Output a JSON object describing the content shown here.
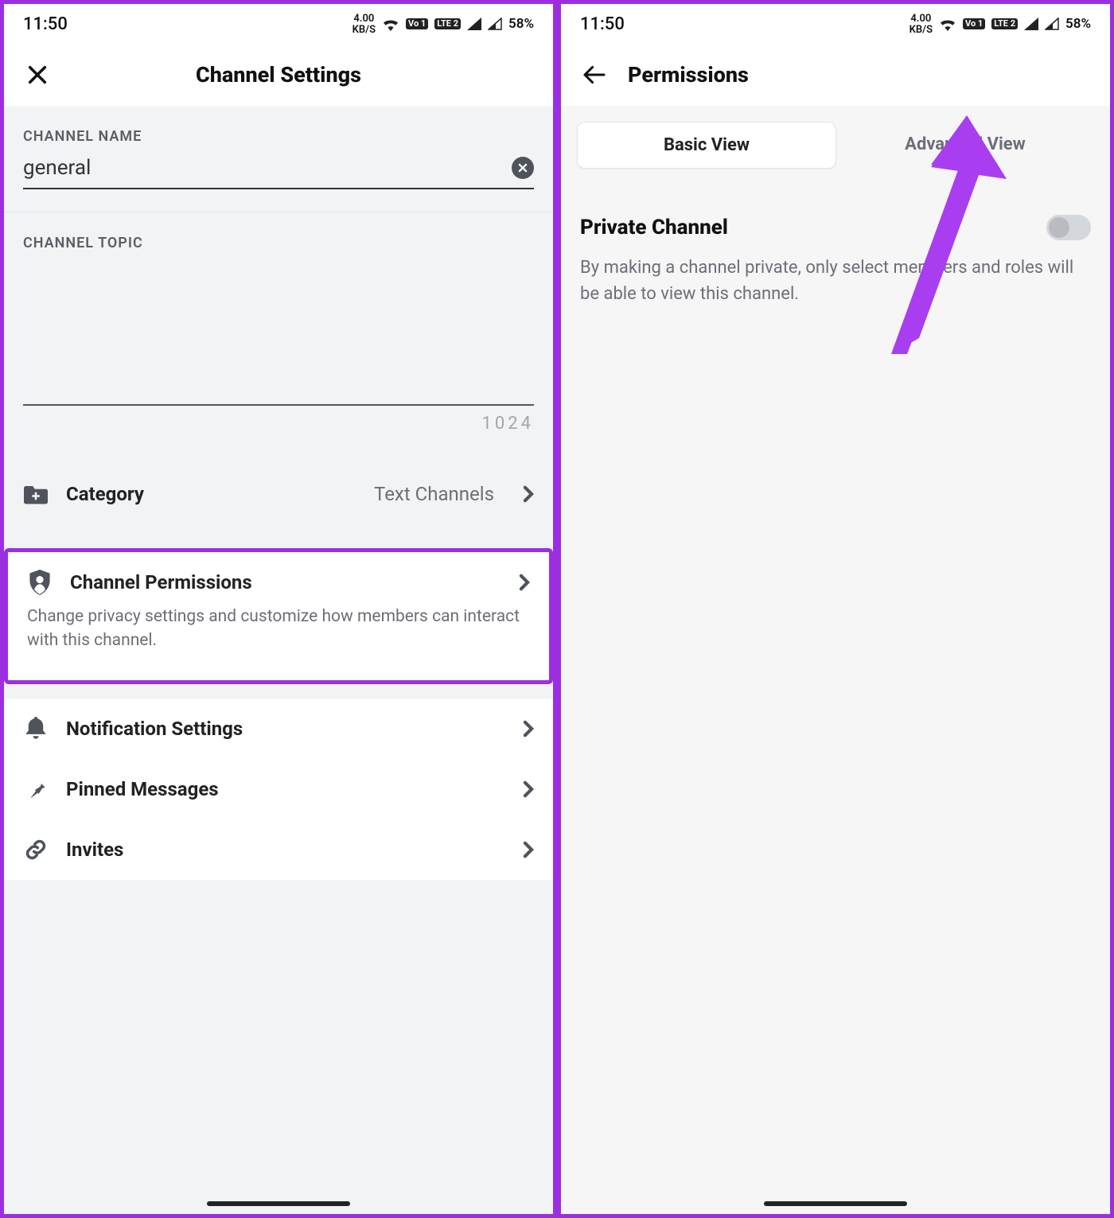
{
  "status": {
    "time": "11:50",
    "kbps": "4.00",
    "kbps_unit": "KB/S",
    "lte1": "Vo 1",
    "lte2": "LTE 2",
    "battery": "58%"
  },
  "left": {
    "title": "Channel Settings",
    "channel_name_label": "CHANNEL NAME",
    "channel_name_value": "general",
    "channel_topic_label": "CHANNEL TOPIC",
    "topic_counter": "1024",
    "rows": {
      "category": {
        "label": "Category",
        "value": "Text Channels"
      },
      "permissions": {
        "label": "Channel Permissions",
        "desc": "Change privacy settings and customize how members can interact with this channel."
      },
      "notifications": {
        "label": "Notification Settings"
      },
      "pinned": {
        "label": "Pinned Messages"
      },
      "invites": {
        "label": "Invites"
      }
    }
  },
  "right": {
    "title": "Permissions",
    "tab_basic": "Basic View",
    "tab_advanced": "Advanced View",
    "private_channel_label": "Private Channel",
    "private_channel_desc": "By making a channel private, only select members and roles will be able to view this channel."
  }
}
